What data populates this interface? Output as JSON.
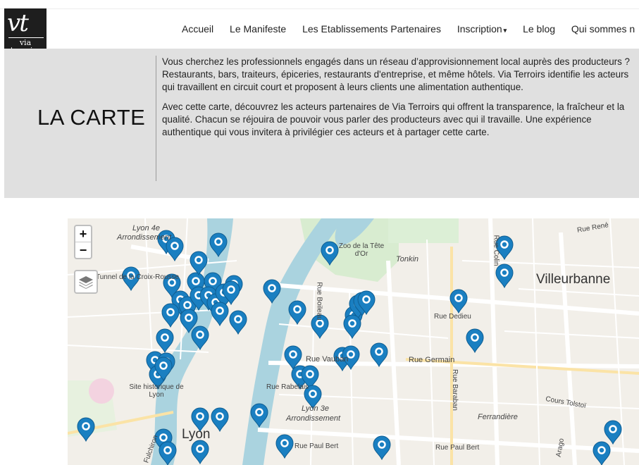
{
  "logo": {
    "mark": "vt",
    "line1": "via",
    "line2": "terroirs"
  },
  "nav": {
    "items": [
      {
        "label": "Accueil"
      },
      {
        "label": "Le Manifeste"
      },
      {
        "label": "Les Etablissements Partenaires"
      },
      {
        "label": "Inscription"
      },
      {
        "label": "Le blog"
      },
      {
        "label": "Qui sommes n"
      }
    ],
    "caret": "▾"
  },
  "hero": {
    "title": "LA CARTE",
    "paragraph1": "Vous cherchez les professionnels engagés dans un réseau d’approvisionnement local auprès des producteurs ? Restaurants, bars, traiteurs, épiceries, restaurants d'entreprise, et même hôtels. Via Terroirs identifie les acteurs qui travaillent en circuit court et proposent à leurs clients une alimentation authentique.",
    "paragraph2": "Avec cette carte, découvrez les acteurs partenaires de Via Terroirs qui offrent la transparence, la fraîcheur et la qualité. Chacun se réjouira de pouvoir vous parler des producteurs avec qui il travaille. Une expérience authentique qui vous invitera à privilégier ces acteurs et à partager cette carte."
  },
  "map": {
    "zoom_in": "+",
    "zoom_out": "−",
    "marker_color": "#1a7fc1",
    "labels": [
      "Lyon 4e",
      "Arrondissement",
      "Tunnel de la Croix-Rousse",
      "Zoo de la Tête d'Or",
      "Tonkin",
      "Villeurbanne",
      "Rue René",
      "Rue Colin",
      "Rue Dedieu",
      "Rue Germain",
      "Rue Vauban",
      "Rue Rabelais",
      "Site historique de Lyon",
      "Lyon 3e",
      "Arrondissement",
      "Lyon",
      "Ferrandière",
      "Cours Tolstoï",
      "Rue Paul Bert",
      "Rue Paul Bert",
      "Rue Baraban",
      "Rue Boileau",
      "Fulchiron",
      "Arago"
    ]
  }
}
